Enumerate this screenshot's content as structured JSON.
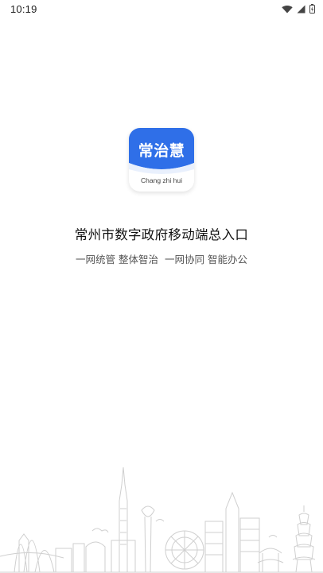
{
  "status_bar": {
    "time": "10:19",
    "icons": [
      "wifi-icon",
      "signal-icon",
      "battery-icon"
    ]
  },
  "app_logo": {
    "name": "常治慧",
    "pinyin": "Chang zhi hui",
    "brand_color": "#2f6fe8"
  },
  "splash": {
    "title": "常州市数字政府移动端总入口",
    "subtitle": "一网统管 整体智治  一网协同 智能办公"
  },
  "illustration": {
    "name": "city-skyline",
    "stroke_color": "#c8c8c8"
  }
}
